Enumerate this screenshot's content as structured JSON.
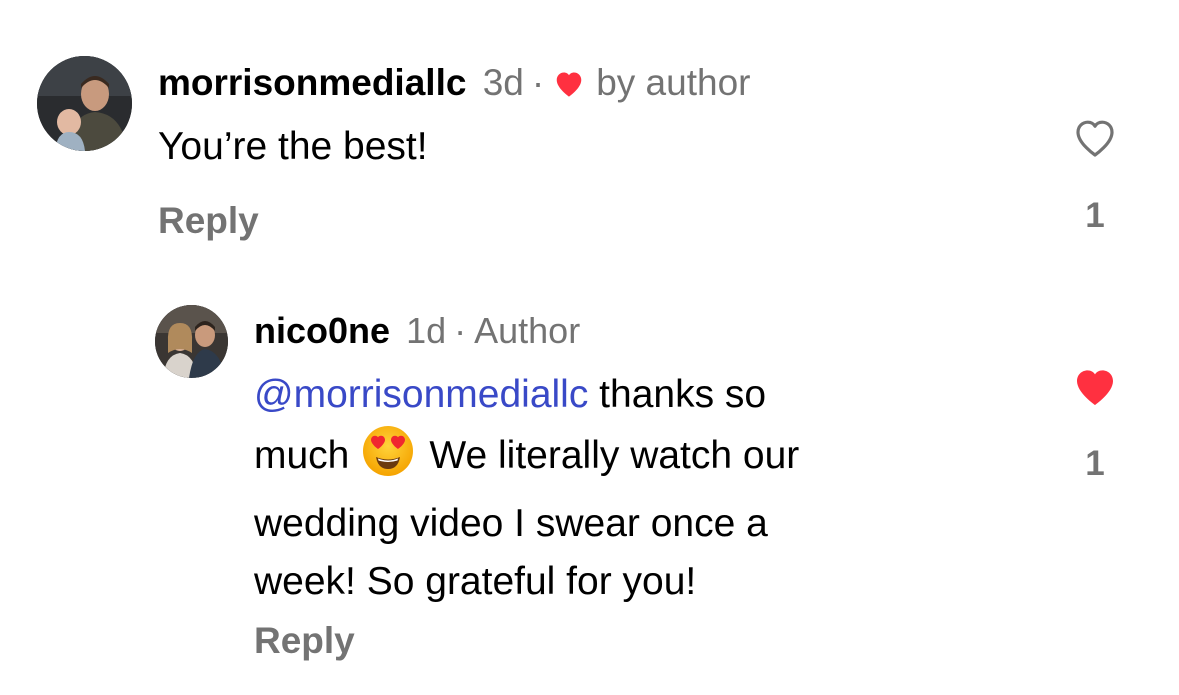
{
  "comments": [
    {
      "username": "morrisonmediallc",
      "time": "3d",
      "dot": "·",
      "author_tag": "by author",
      "text": "You’re the best!",
      "reply_label": "Reply",
      "like_count": "1",
      "liked": false
    },
    {
      "username": "nico0ne",
      "time": "1d",
      "dot": "·",
      "author_tag": "Author",
      "mention": "@morrisonmediallc",
      "text_line1_rest": " thanks so",
      "text_line2_a": "much",
      "text_line2_b": "We literally watch our",
      "text_line3": "wedding video I swear once a",
      "text_line4": "week! So grateful for you!",
      "reply_label": "Reply",
      "like_count": "1",
      "liked": true
    }
  ],
  "colors": {
    "heart_red": "#ff3040",
    "muted": "#737373",
    "mention": "#3949c7"
  },
  "icons": {
    "author_liked": "heart-filled-icon",
    "like_empty": "heart-outline-icon",
    "like_filled": "heart-filled-icon",
    "emoji": "heart-eyes-emoji"
  }
}
